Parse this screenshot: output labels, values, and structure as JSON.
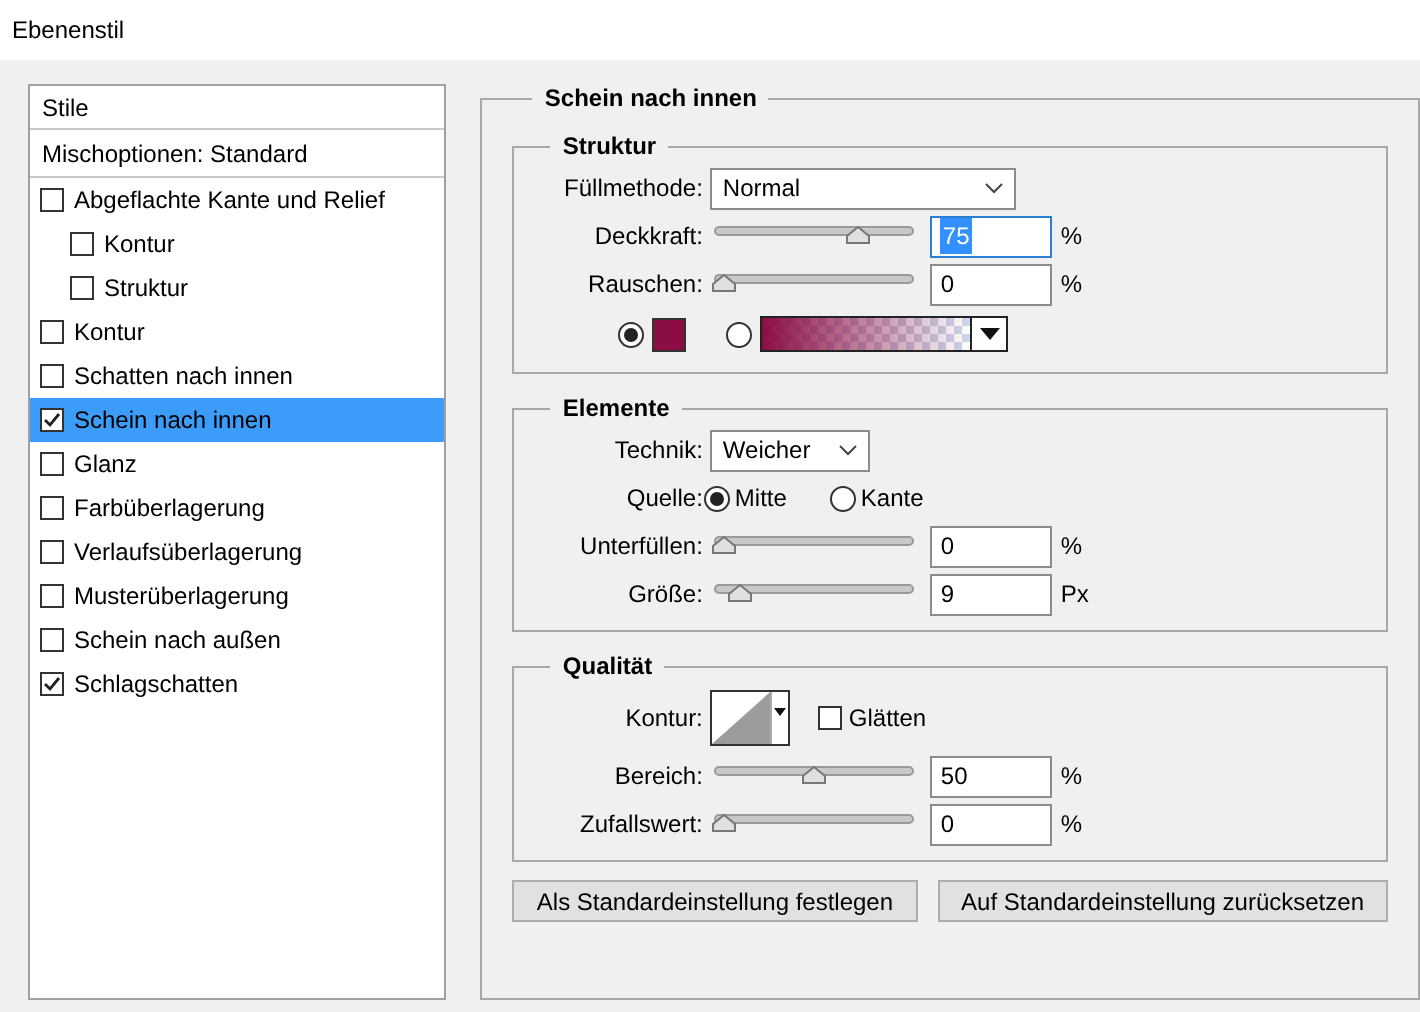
{
  "window": {
    "title": "Ebenenstil"
  },
  "sidebar": {
    "header": "Stile",
    "blend_options": "Mischoptionen: Standard",
    "items": [
      {
        "label": "Abgeflachte Kante und Relief",
        "checked": false,
        "selected": false,
        "children": [
          {
            "label": "Kontur",
            "checked": false,
            "selected": false
          },
          {
            "label": "Struktur",
            "checked": false,
            "selected": false
          }
        ]
      },
      {
        "label": "Kontur",
        "checked": false,
        "selected": false
      },
      {
        "label": "Schatten nach innen",
        "checked": false,
        "selected": false
      },
      {
        "label": "Schein nach innen",
        "checked": true,
        "selected": true
      },
      {
        "label": "Glanz",
        "checked": false,
        "selected": false
      },
      {
        "label": "Farbüberlagerung",
        "checked": false,
        "selected": false
      },
      {
        "label": "Verlaufsüberlagerung",
        "checked": false,
        "selected": false
      },
      {
        "label": "Musterüberlagerung",
        "checked": false,
        "selected": false
      },
      {
        "label": "Schein nach außen",
        "checked": false,
        "selected": false
      },
      {
        "label": "Schlagschatten",
        "checked": true,
        "selected": false
      }
    ]
  },
  "panel": {
    "title": "Schein nach innen",
    "sections": [
      {
        "title": "Struktur",
        "rows": [
          {
            "kind": "dropdown",
            "label": "Füllmethode:",
            "value": "Normal",
            "wide": true
          },
          {
            "kind": "slider",
            "label": "Deckkraft:",
            "level": 0.75,
            "value": "75",
            "unit": "%",
            "focused": true
          },
          {
            "kind": "slider",
            "label": "Rauschen:",
            "level": 0,
            "value": "0",
            "unit": "%",
            "focused": false
          },
          {
            "kind": "fill",
            "options": [
              {
                "kind": "color",
                "color": "#8b0d45",
                "selected": true
              },
              {
                "kind": "gradient",
                "color": "#8b0d45",
                "selected": false
              }
            ]
          }
        ]
      },
      {
        "title": "Elemente",
        "rows": [
          {
            "kind": "dropdown",
            "label": "Technik:",
            "value": "Weicher",
            "wide": false
          },
          {
            "kind": "radio",
            "label": "Quelle:",
            "options": [
              {
                "label": "Mitte",
                "selected": true
              },
              {
                "label": "Kante",
                "selected": false
              }
            ]
          },
          {
            "kind": "slider",
            "label": "Unterfüllen:",
            "level": 0,
            "value": "0",
            "unit": "%",
            "focused": false
          },
          {
            "kind": "slider",
            "label": "Größe:",
            "level": 0.09,
            "value": "9",
            "unit": "Px",
            "focused": false
          }
        ]
      },
      {
        "title": "Qualität",
        "rows": [
          {
            "kind": "contour",
            "label": "Kontur:",
            "checkbox": {
              "label": "Glätten",
              "checked": false
            }
          },
          {
            "kind": "slider",
            "label": "Bereich:",
            "level": 0.5,
            "value": "50",
            "unit": "%",
            "focused": false
          },
          {
            "kind": "slider",
            "label": "Zufallswert:",
            "level": 0,
            "value": "0",
            "unit": "%",
            "focused": false
          }
        ]
      }
    ],
    "buttons": [
      "Als Standardeinstellung festlegen",
      "Auf Standardeinstellung zurücksetzen"
    ]
  }
}
